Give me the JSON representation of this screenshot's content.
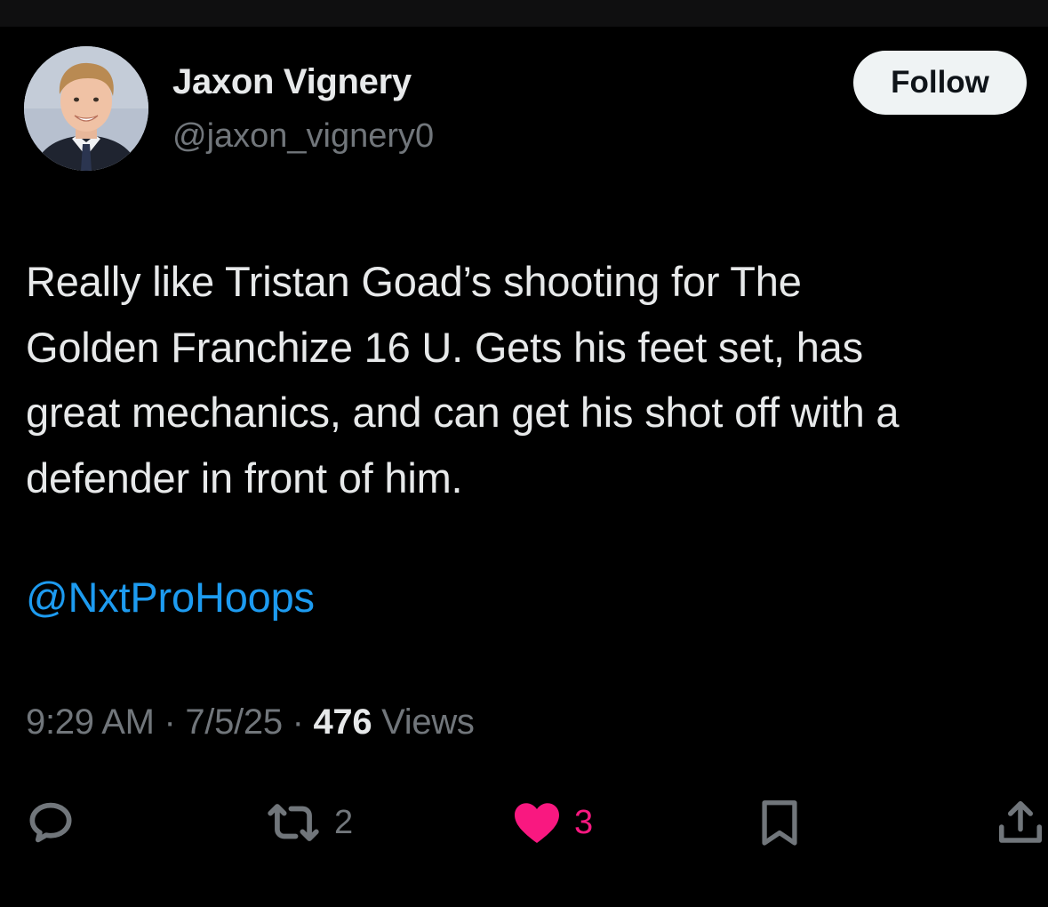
{
  "author": {
    "name": "Jaxon Vignery",
    "handle": "@jaxon_vignery0"
  },
  "follow_label": "Follow",
  "tweet": {
    "text": "Really like Tristan Goad’s shooting for The\nGolden Franchize 16 U. Gets his feet set, has\ngreat mechanics, and can get his shot off with a\ndefender in front of him.",
    "mention": "@NxtProHoops"
  },
  "meta": {
    "time": "9:29 AM",
    "separator": "·",
    "date": "7/5/25",
    "views_count": "476",
    "views_label": "Views"
  },
  "actions": {
    "reply": {
      "icon": "reply-icon"
    },
    "retweet": {
      "icon": "retweet-icon",
      "count": "2"
    },
    "like": {
      "icon": "heart-icon",
      "count": "3",
      "liked": true
    },
    "bookmark": {
      "icon": "bookmark-icon"
    },
    "share": {
      "icon": "share-icon"
    }
  },
  "colors": {
    "background": "#000000",
    "text_primary": "#e7e9ea",
    "text_secondary": "#71767b",
    "link": "#1d9bf0",
    "like": "#f91880",
    "follow_bg": "#eff3f4",
    "follow_text": "#0f1419"
  }
}
